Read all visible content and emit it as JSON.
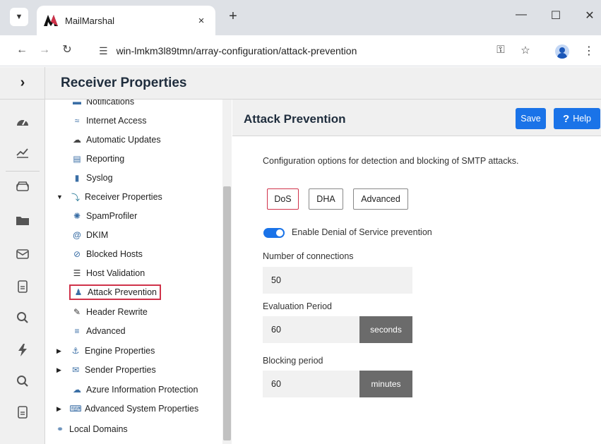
{
  "browser": {
    "tab_title": "MailMarshal",
    "url": "win-lmkm3l89tmn/array-configuration/attack-prevention",
    "new_tab_symbol": "+",
    "tab_close_symbol": "×",
    "minimize_symbol": "—",
    "maximize_symbol": "☐",
    "close_symbol": "✕"
  },
  "header": {
    "title": "Receiver Properties"
  },
  "tree": {
    "items": [
      {
        "label": "Notifications",
        "icon": "notifications-icon"
      },
      {
        "label": "Internet Access",
        "icon": "wifi-icon"
      },
      {
        "label": "Automatic Updates",
        "icon": "cloud-upload-icon"
      },
      {
        "label": "Reporting",
        "icon": "chart-icon"
      },
      {
        "label": "Syslog",
        "icon": "file-icon"
      },
      {
        "label": "Receiver Properties",
        "icon": "receiver-icon",
        "expanded": true
      },
      {
        "label": "SpamProfiler",
        "icon": "spam-icon"
      },
      {
        "label": "DKIM",
        "icon": "at-icon"
      },
      {
        "label": "Blocked Hosts",
        "icon": "blocked-icon"
      },
      {
        "label": "Host Validation",
        "icon": "server-icon"
      },
      {
        "label": "Attack Prevention",
        "icon": "users-icon",
        "selected": true
      },
      {
        "label": "Header Rewrite",
        "icon": "pencil-icon"
      },
      {
        "label": "Advanced",
        "icon": "sliders-icon"
      },
      {
        "label": "Engine Properties",
        "icon": "engine-icon",
        "collapsed": true
      },
      {
        "label": "Sender Properties",
        "icon": "envelope-icon",
        "collapsed": true
      },
      {
        "label": "Azure Information Protection",
        "icon": "cloud-icon"
      },
      {
        "label": "Advanced System Properties",
        "icon": "keyboard-icon",
        "collapsed": true
      },
      {
        "label": "Local Domains",
        "icon": "globe-icon"
      }
    ]
  },
  "main": {
    "title": "Attack Prevention",
    "save_label": "Save",
    "help_label": "Help",
    "help_symbol": "?",
    "description": "Configuration options for detection and blocking of SMTP attacks.",
    "tabs": [
      "DoS",
      "DHA",
      "Advanced"
    ],
    "active_tab": "DoS",
    "toggle_label": "Enable Denial of Service prevention",
    "toggle_on": true,
    "fields": {
      "connections_label": "Number of connections",
      "connections_value": "50",
      "evaluation_label": "Evaluation Period",
      "evaluation_value": "60",
      "evaluation_unit": "seconds",
      "blocking_label": "Blocking period",
      "blocking_value": "60",
      "blocking_unit": "minutes"
    }
  },
  "colors": {
    "accent": "#1a73e8",
    "selected_border": "#d0324a",
    "unit_bg": "#6b6b6b"
  }
}
